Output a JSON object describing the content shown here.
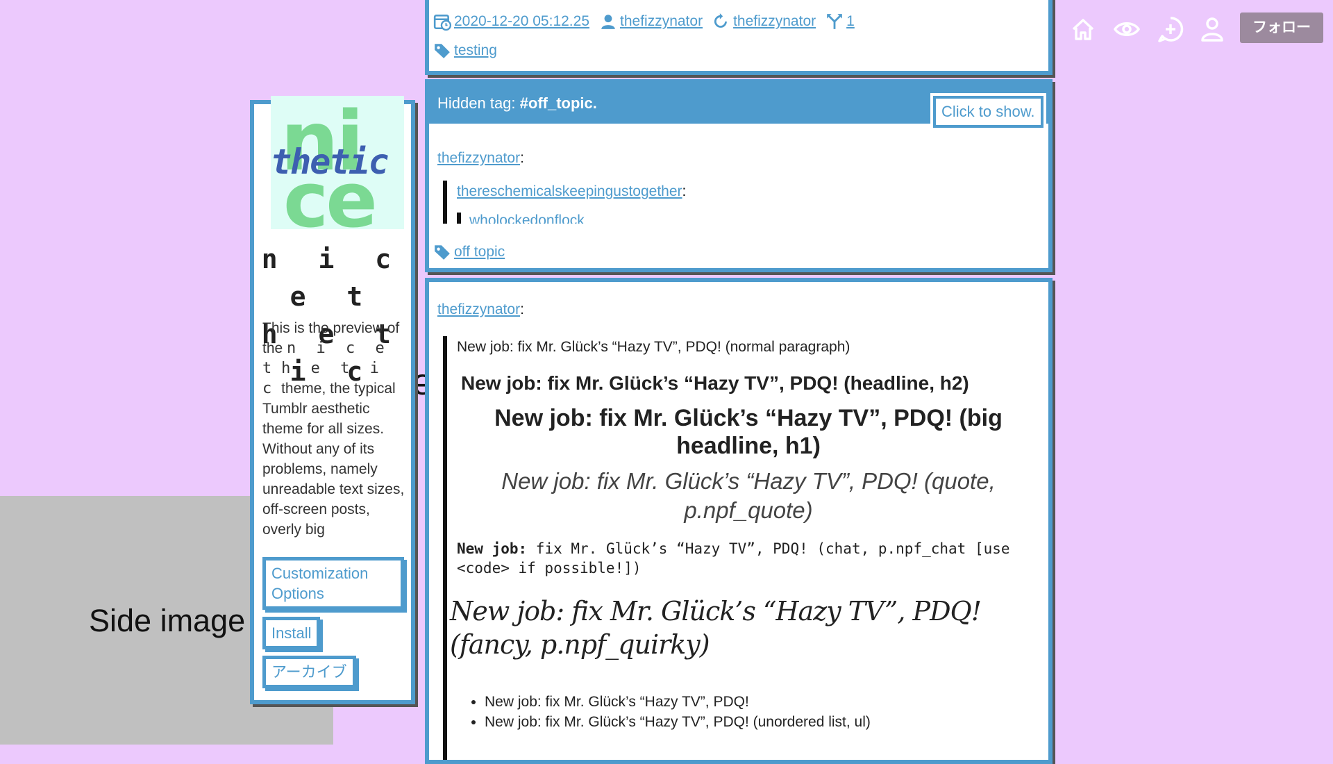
{
  "side_image": {
    "label": "Side image"
  },
  "sidebar": {
    "logo": {
      "top": "ni",
      "middle": "thetic",
      "bottom": "ce"
    },
    "title_line1": "n i c e t",
    "title_line2": "h e t i c",
    "desc_1": "This is the preview of the",
    "desc_name1": "n i c e t",
    "desc_name2": "h e t i c",
    "desc_2": "theme, the typical Tumblr aesthetic theme for all sizes. Without any of its problems, namely unreadable text sizes, off-screen posts, overly big",
    "buttons": {
      "customize": "Customization Options",
      "install": "Install",
      "archive": "アーカイブ"
    }
  },
  "post1": {
    "date": "2020-12-20 05:12.25",
    "author": "thefizzynator",
    "reblogged_from": "thefizzynator",
    "notes": "1",
    "tag": "testing"
  },
  "post2": {
    "hidden_prefix": "Hidden tag: ",
    "hidden_tag": "#off_topic.",
    "show_button": "Click to show.",
    "author": "thefizzynator",
    "reblog1": "thereschemicalskeepingustogether",
    "reblog2": "wholockedonflock",
    "tag": "off topic"
  },
  "post3": {
    "author": "thefizzynator",
    "normal": "New job: fix Mr. Glück’s “Hazy TV”, PDQ! (normal paragraph)",
    "h2": "New job: fix Mr. Glück’s “Hazy TV”, PDQ! (headline, h2)",
    "h1": "New job: fix Mr. Glück’s “Hazy TV”, PDQ! (big headline, h1)",
    "quote": "New job: fix Mr. Glück’s “Hazy TV”, PDQ! (quote, p.npf_quote)",
    "chat": "New job: fix Mr. Glück’s “Hazy TV”, PDQ! (chat, p.npf_chat [use <code> if possible!])",
    "chat_label": "New job:",
    "chat_rest": " fix Mr. Glück’s “Hazy TV”, PDQ! (chat, p.npf_chat [use <code> if possible!])",
    "fancy": "New job: fix Mr. Glück’s “Hazy TV”, PDQ! (fancy, p.npf_quirky)",
    "list": [
      "New job: fix Mr. Glück’s “Hazy TV”, PDQ!",
      "New job: fix Mr. Glück’s “Hazy TV”, PDQ! (unordered list, ul)"
    ]
  },
  "nav": {
    "icons": [
      "home-icon",
      "eye-icon",
      "plus-icon",
      "user-icon"
    ],
    "follow_label": "フォロー"
  },
  "colors": {
    "background": "#ecc9fd",
    "accent": "#4e9bcd",
    "follow": "#9c8a9e"
  }
}
